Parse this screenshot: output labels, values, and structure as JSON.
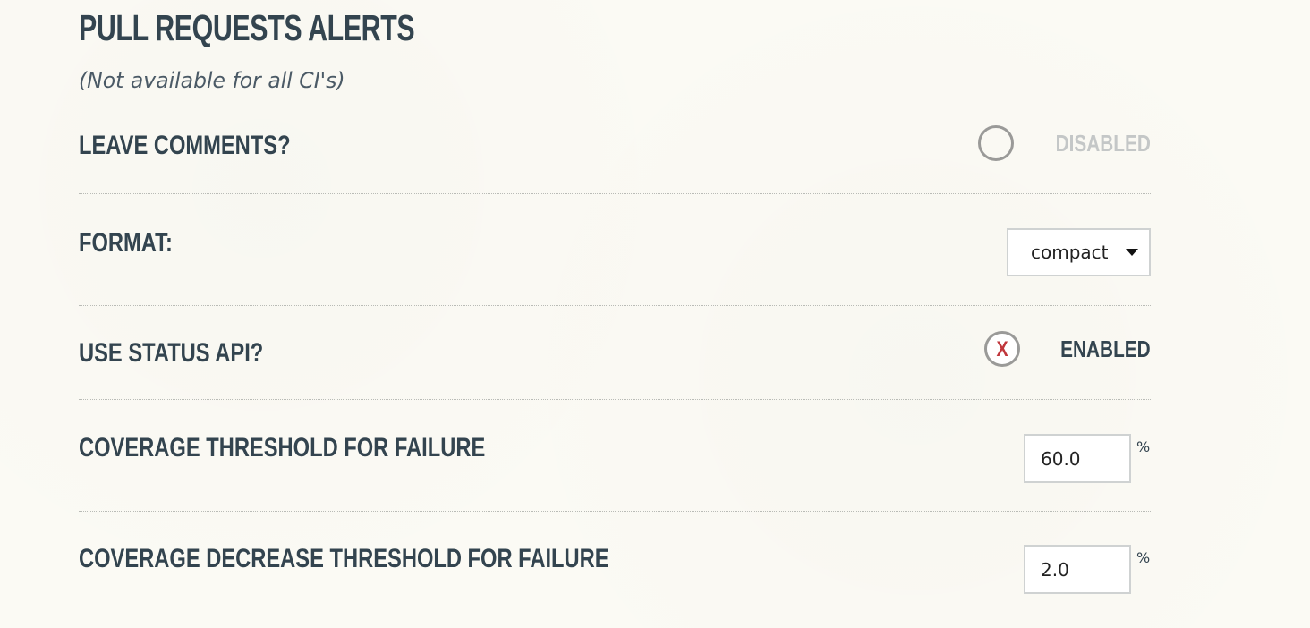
{
  "section": {
    "title": "PULL REQUESTS ALERTS",
    "subtitle": "(Not available for all CI's)"
  },
  "settings": {
    "leave_comments": {
      "label": "LEAVE COMMENTS?",
      "state": "DISABLED",
      "enabled": false
    },
    "format": {
      "label": "FORMAT:",
      "selected": "compact"
    },
    "use_status_api": {
      "label": "USE STATUS API?",
      "state": "ENABLED",
      "enabled": true,
      "mark": "X"
    },
    "coverage_threshold": {
      "label": "COVERAGE THRESHOLD FOR FAILURE",
      "value": "60.0",
      "unit": "%"
    },
    "coverage_decrease_threshold": {
      "label": "COVERAGE DECREASE THRESHOLD FOR FAILURE",
      "value": "2.0",
      "unit": "%"
    }
  },
  "colors": {
    "background": "#fbfaf4",
    "text": "#33444f",
    "disabled_text": "#c4c7c7",
    "toggle_mark": "#c0363b",
    "toggle_ring": "#9a9a98"
  },
  "icons": {
    "off_toggle": "empty-circle-icon",
    "on_toggle": "x-mark-icon",
    "select_caret": "caret-down-icon"
  }
}
